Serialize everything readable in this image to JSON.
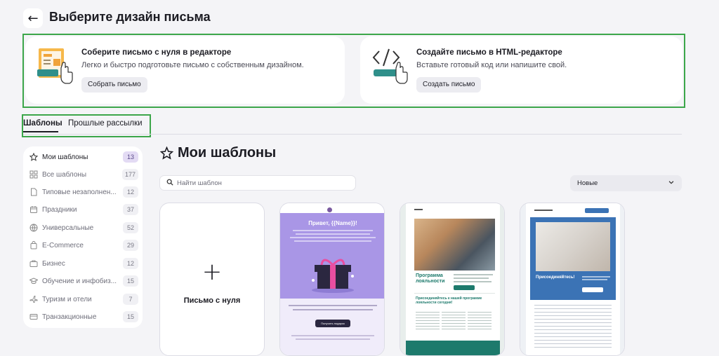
{
  "header": {
    "title": "Выберите дизайн письма"
  },
  "cards": [
    {
      "title": "Соберите письмо с нуля в редакторе",
      "subtitle": "Легко и быстро подготовьте письмо с собственным дизайном.",
      "button": "Собрать письмо"
    },
    {
      "title": "Создайте письмо в HTML-редакторе",
      "subtitle": "Вставьте готовый код или напишите свой.",
      "button": "Создать письмо"
    }
  ],
  "tabs": [
    {
      "label": "Шаблоны",
      "active": true
    },
    {
      "label": "Прошлые рассылки",
      "active": false
    }
  ],
  "sidebar": {
    "items": [
      {
        "label": "Мои шаблоны",
        "count": "13",
        "icon": "star-icon",
        "active": true
      },
      {
        "label": "Все шаблоны",
        "count": "177",
        "icon": "grid-icon"
      },
      {
        "label": "Типовые незаполнен...",
        "count": "12",
        "icon": "document-icon"
      },
      {
        "label": "Праздники",
        "count": "37",
        "icon": "calendar-icon"
      },
      {
        "label": "Универсальные",
        "count": "52",
        "icon": "globe-icon"
      },
      {
        "label": "E-Commerce",
        "count": "29",
        "icon": "bag-icon"
      },
      {
        "label": "Бизнес",
        "count": "12",
        "icon": "briefcase-icon"
      },
      {
        "label": "Обучение и инфобиз...",
        "count": "15",
        "icon": "graduation-cap-icon"
      },
      {
        "label": "Туризм и отели",
        "count": "7",
        "icon": "airplane-icon"
      },
      {
        "label": "Транзакционные",
        "count": "15",
        "icon": "receipt-icon"
      }
    ]
  },
  "main": {
    "title": "Мои шаблоны",
    "search_placeholder": "Найти шаблон",
    "sort_value": "Новые",
    "blank_label": "Письмо с нуля",
    "templates": [
      {
        "heading": "Привет, {{Name}}!",
        "cta": "Получить подарок"
      },
      {
        "heading": "Программа лояльности",
        "subheading": "Присоединяйтесь к нашей программе лояльности сегодня!"
      },
      {
        "heading": "Присоединяйтесь!"
      }
    ]
  },
  "colors": {
    "accent_green": "#3ca64a",
    "purple": "#a996e6",
    "teal": "#1d7a6c",
    "blue": "#3b73b5"
  }
}
